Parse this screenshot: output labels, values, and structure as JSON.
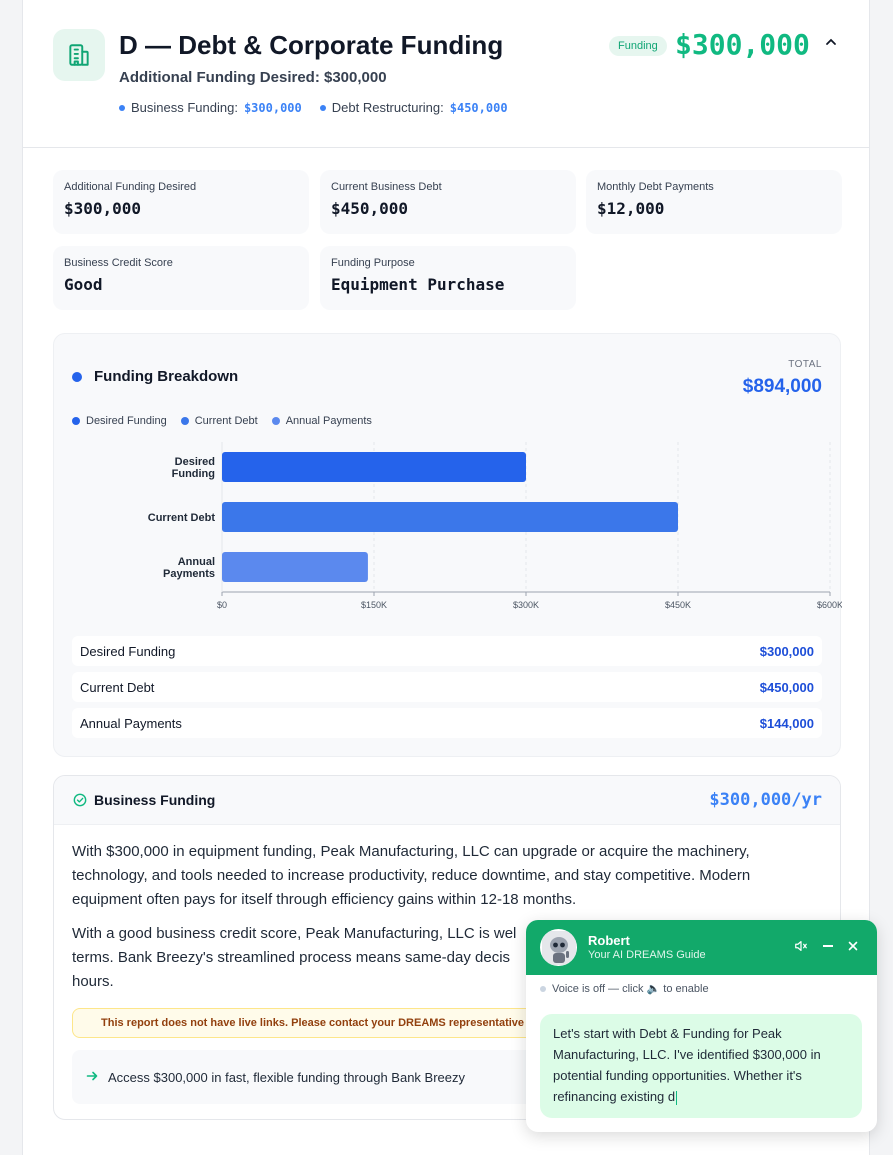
{
  "header": {
    "title": "D — Debt & Corporate Funding",
    "subtitle": "Additional Funding Desired: $300,000",
    "tag": "Funding",
    "amount": "$300,000",
    "pills": [
      {
        "label": "Business Funding:",
        "value": "$300,000"
      },
      {
        "label": "Debt Restructuring:",
        "value": "$450,000"
      }
    ]
  },
  "stats": [
    {
      "label": "Additional Funding Desired",
      "value": "$300,000"
    },
    {
      "label": "Current Business Debt",
      "value": "$450,000"
    },
    {
      "label": "Monthly Debt Payments",
      "value": "$12,000"
    },
    {
      "label": "Business Credit Score",
      "value": "Good"
    },
    {
      "label": "Funding Purpose",
      "value": "Equipment Purchase"
    }
  ],
  "breakdown": {
    "title": "Funding Breakdown",
    "total_label": "TOTAL",
    "total_value": "$894,000",
    "rows": [
      {
        "label": "Desired Funding",
        "value": "$300,000"
      },
      {
        "label": "Current Debt",
        "value": "$450,000"
      },
      {
        "label": "Annual Payments",
        "value": "$144,000"
      }
    ]
  },
  "chart_data": {
    "type": "bar",
    "orientation": "horizontal",
    "categories": [
      "Desired Funding",
      "Current Debt",
      "Annual Payments"
    ],
    "values": [
      300000,
      450000,
      144000
    ],
    "colors": [
      "#2563eb",
      "#3b77ea",
      "#5b89ee"
    ],
    "legend": [
      "Desired Funding",
      "Current Debt",
      "Annual Payments"
    ],
    "xlim": [
      0,
      600000
    ],
    "xticks": [
      "$0",
      "$150K",
      "$300K",
      "$450K",
      "$600K"
    ],
    "grid": true,
    "legend_position": "top-left"
  },
  "business_funding": {
    "title": "Business Funding",
    "amount": "$300,000/yr",
    "para1": "With $300,000 in equipment funding, Peak Manufacturing, LLC can upgrade or acquire the machinery, technology, and tools needed to increase productivity, reduce downtime, and stay competitive. Modern equipment often pays for itself through efficiency gains within 12-18 months.",
    "para2": "With a good business credit score, Peak Manufacturing, LLC is wel",
    "para2b": "terms. Bank Breezy's streamlined process means same-day decis",
    "para2c": "hours.",
    "notice": "This report does not have live links. Please contact your DREAMS representative",
    "access": "Access $300,000 in fast, flexible funding through Bank Breezy"
  },
  "chat": {
    "name": "Robert",
    "role": "Your AI DREAMS Guide",
    "voice": "Voice is off — click 🔈 to enable",
    "message": "Let's start with Debt & Funding for Peak Manufacturing, LLC. I've identified $300,000 in potential funding opportunities. Whether it's refinancing existing d"
  }
}
